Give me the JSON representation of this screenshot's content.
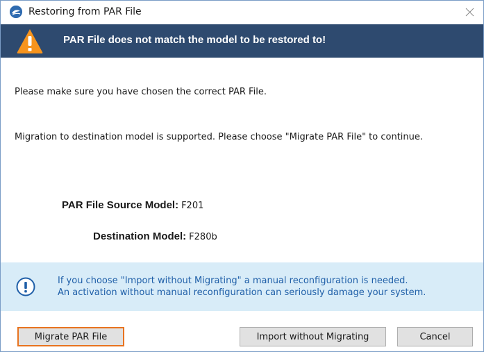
{
  "window": {
    "title": "Restoring from PAR File"
  },
  "header": {
    "message": "PAR File does not match the model to be restored to!"
  },
  "body": {
    "line1": "Please make sure you have chosen the correct PAR File.",
    "line2": "Migration to destination model is supported. Please choose \"Migrate PAR File\" to continue."
  },
  "models": {
    "source_label": "PAR File Source Model:",
    "source_value": "F201",
    "destination_label": "Destination Model:",
    "destination_value": "F280b"
  },
  "info": {
    "line1": "If you choose \"Import without Migrating\" a manual reconfiguration is needed.",
    "line2": "An activation without manual reconfiguration can seriously damage your system."
  },
  "buttons": {
    "migrate": "Migrate PAR File",
    "import": "Import without Migrating",
    "cancel": "Cancel"
  },
  "icons": {
    "app": "app-logo-icon",
    "close": "close-icon",
    "warning": "warning-icon",
    "info": "info-icon"
  },
  "colors": {
    "header_bg": "#2e4a6f",
    "warning": "#f7941d",
    "info_bg": "#d8ecf8",
    "info_text": "#1f5fa8",
    "focus_border": "#e8731f"
  }
}
